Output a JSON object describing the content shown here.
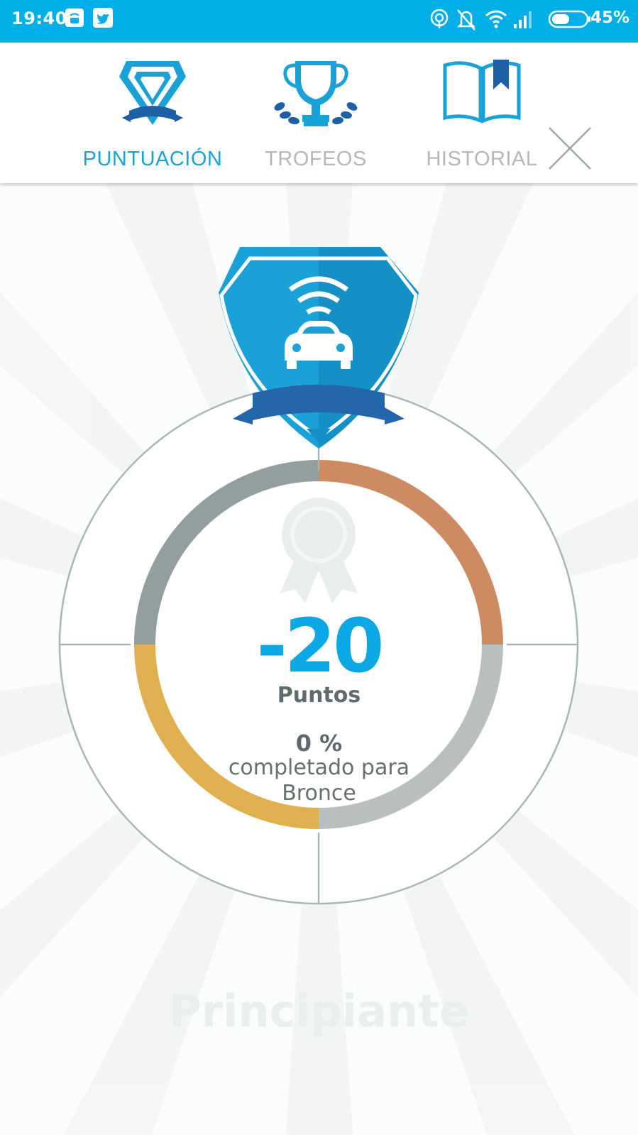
{
  "status_bar": {
    "time": "19:40",
    "battery_percent": "45%",
    "icons": [
      "app-notification-icon",
      "twitter-icon",
      "hotspot-icon",
      "mute-bell-icon",
      "wifi-icon",
      "signal-icon",
      "battery-icon"
    ]
  },
  "tabs": [
    {
      "label": "PUNTUACIÓN",
      "icon": "shield-badge-icon",
      "active": true
    },
    {
      "label": "TROFEOS",
      "icon": "trophy-icon",
      "active": false
    },
    {
      "label": "HISTORIAL",
      "icon": "book-icon",
      "active": false
    }
  ],
  "close_icon": "close-icon",
  "score": {
    "value": "-20",
    "unit": "Puntos",
    "progress_percent": "0 %",
    "progress_line1": "completado para",
    "progress_line2": "Bronce"
  },
  "level": {
    "name": "Principiante"
  },
  "colors": {
    "primary": "#00aee8",
    "tab_active": "#1aa2d8",
    "tab_inactive": "#b7b7b7",
    "ring_gray": "#939e9e",
    "ring_bronze": "#ce8a61",
    "ring_silver": "#b9bfbe",
    "ring_gold": "#e0b050"
  }
}
